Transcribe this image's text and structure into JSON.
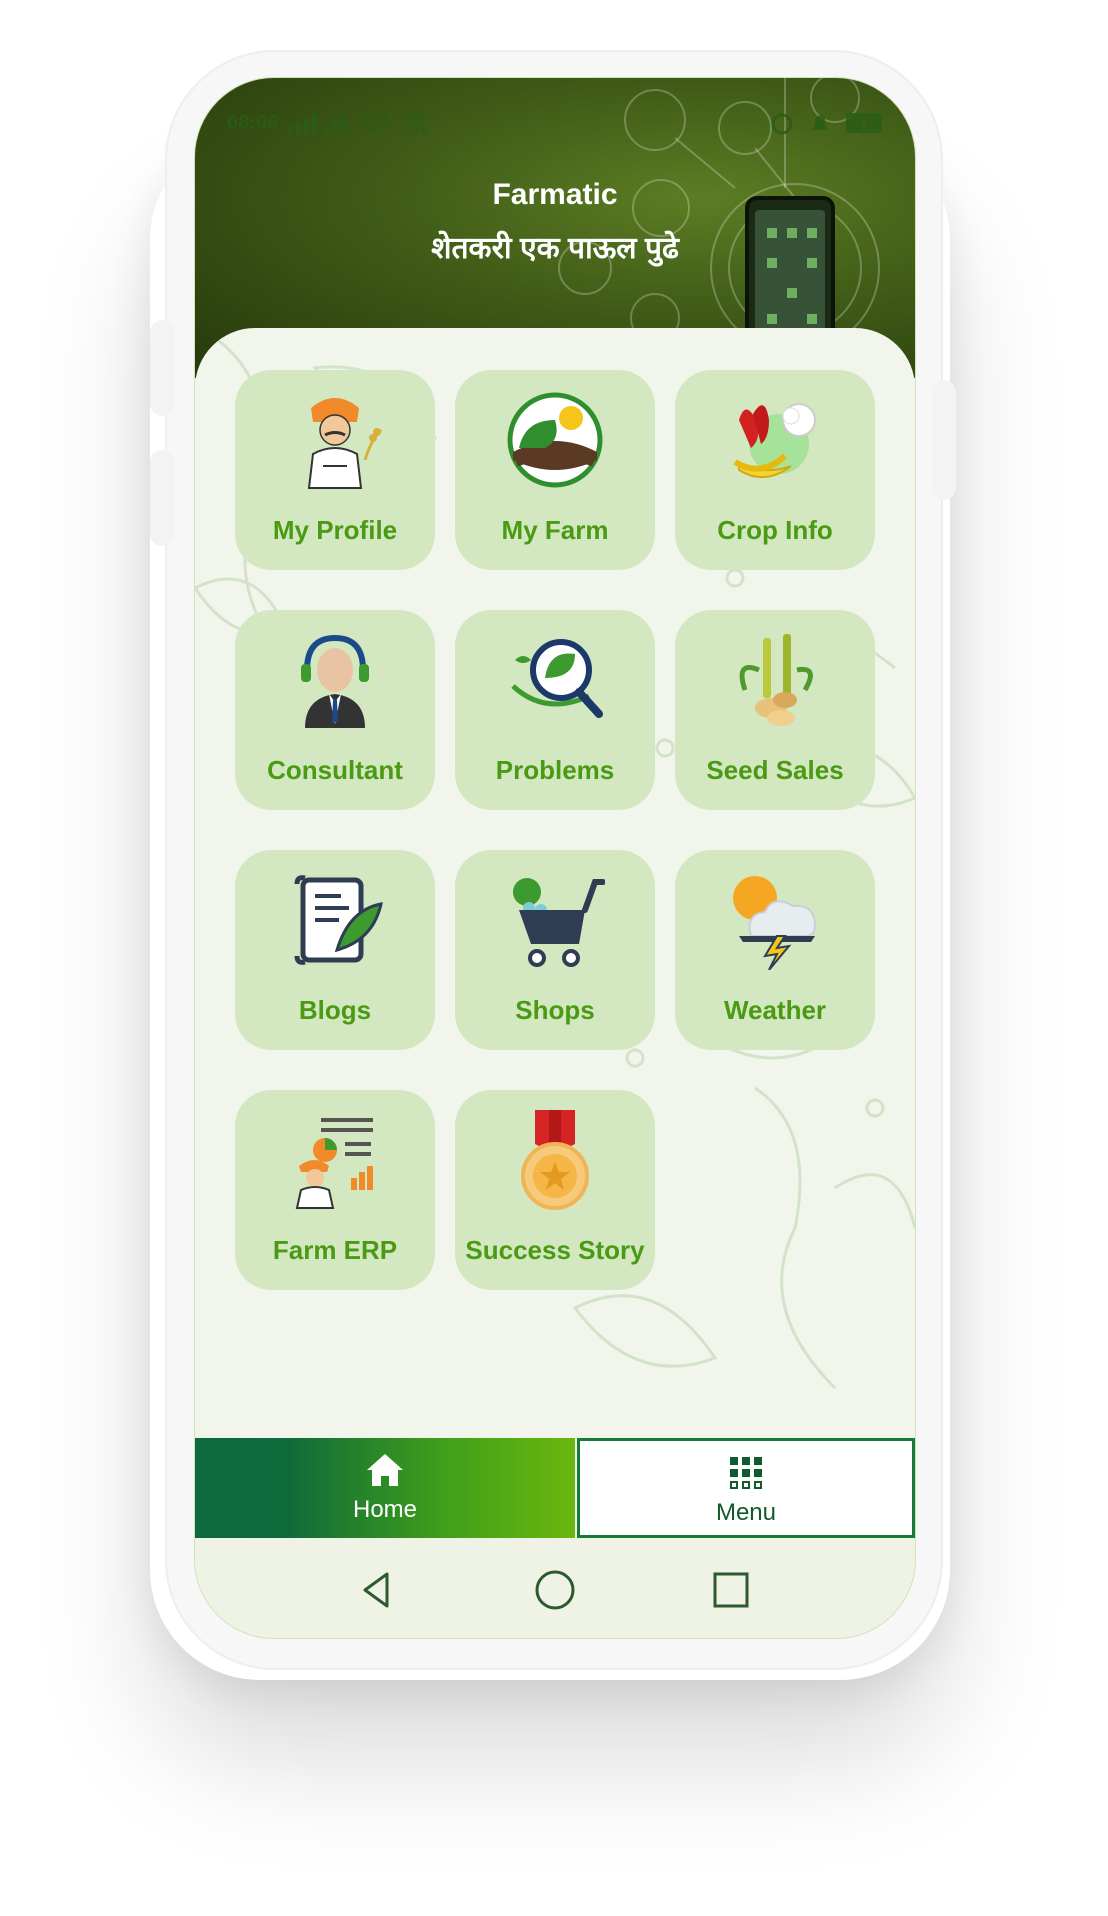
{
  "status_bar": {
    "time": "08:06",
    "network": "VO LTE",
    "speed": "143.5 KB/S"
  },
  "header": {
    "title": "Farmatic",
    "subtitle": "शेतकरी एक पाऊल पुढे"
  },
  "tiles": [
    {
      "label": "My Profile",
      "icon": "farmer-icon"
    },
    {
      "label": "My Farm",
      "icon": "farm-field-icon"
    },
    {
      "label": "Crop Info",
      "icon": "crops-icon"
    },
    {
      "label": "Consultant",
      "icon": "consultant-headset-icon"
    },
    {
      "label": "Problems",
      "icon": "leaf-magnifier-icon"
    },
    {
      "label": "Seed Sales",
      "icon": "seed-sugarcane-icon"
    },
    {
      "label": "Blogs",
      "icon": "scroll-quill-icon"
    },
    {
      "label": "Shops",
      "icon": "shopping-cart-icon"
    },
    {
      "label": "Weather",
      "icon": "weather-storm-icon"
    },
    {
      "label": "Farm ERP",
      "icon": "farm-erp-icon"
    },
    {
      "label": "Success Story",
      "icon": "medal-icon"
    }
  ],
  "tabs": {
    "home": "Home",
    "menu": "Menu"
  },
  "colors": {
    "accent": "#4a9a13",
    "tile_bg": "#d3e8c0",
    "tab_dark": "#0b6a3e",
    "tab_light": "#6ab70f"
  }
}
